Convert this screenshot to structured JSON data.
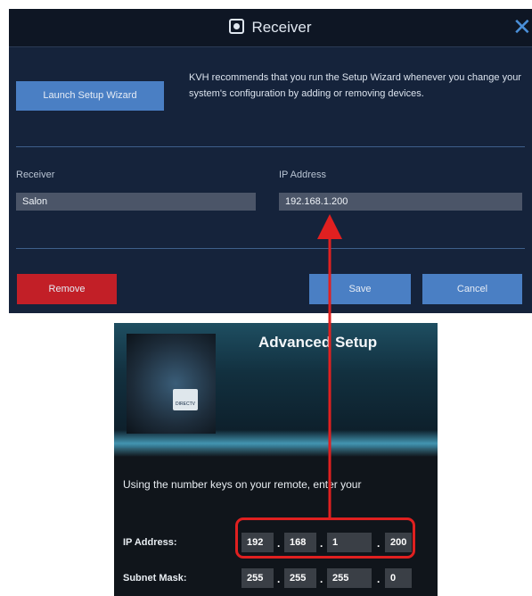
{
  "dialog": {
    "title": "Receiver",
    "close_glyph": "✕",
    "wizard_button": "Launch Setup Wizard",
    "recommendation": "KVH recommends that you run the Setup Wizard whenever you change your system's configuration by adding or removing devices.",
    "receiver_label": "Receiver",
    "receiver_value": "Salon",
    "ip_label": "IP Address",
    "ip_value": "192.168.1.200",
    "remove_button": "Remove",
    "save_button": "Save",
    "cancel_button": "Cancel"
  },
  "tv": {
    "heading": "Advanced Setup",
    "logo_text": "DIRECTV",
    "instructions": "Using the number keys on your remote, enter your",
    "ip_label": "IP Address:",
    "ip_octets": [
      "192",
      "168",
      "1",
      "200"
    ],
    "subnet_label": "Subnet Mask:",
    "subnet_octets": [
      "255",
      "255",
      "255",
      "0"
    ]
  },
  "colors": {
    "dialog_bg": "#15233b",
    "accent_blue": "#4a7fc4",
    "remove_red": "#c21f27",
    "annotation_red": "#e02020"
  }
}
